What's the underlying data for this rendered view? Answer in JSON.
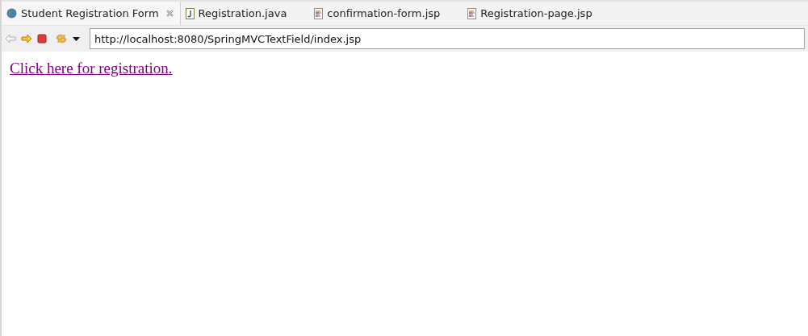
{
  "tabs": [
    {
      "label": "Student Registration Form",
      "kind": "browser",
      "selected": true,
      "closable": true
    },
    {
      "label": "Registration.java",
      "kind": "java",
      "selected": false,
      "closable": false
    },
    {
      "label": "confirmation-form.jsp",
      "kind": "jsp",
      "selected": false,
      "closable": false
    },
    {
      "label": "Registration-page.jsp",
      "kind": "jsp",
      "selected": false,
      "closable": false
    }
  ],
  "toolbar": {
    "back_disabled": true,
    "address": "http://localhost:8080/SpringMVCTextField/index.jsp"
  },
  "page": {
    "link": "Click here for registration."
  }
}
